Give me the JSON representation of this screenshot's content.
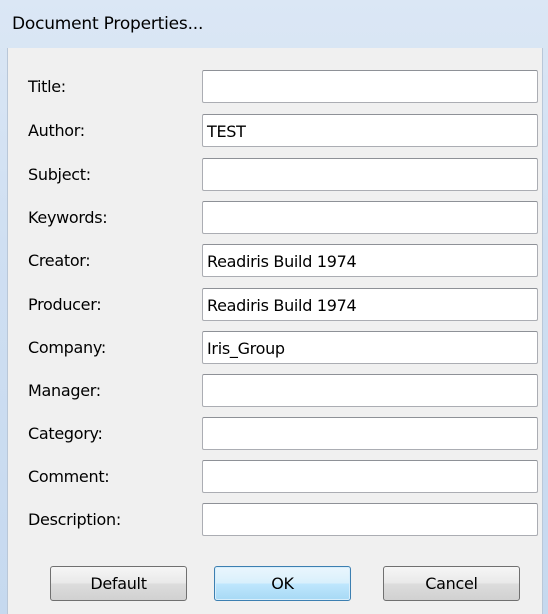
{
  "dialog": {
    "title": "Document Properties..."
  },
  "fields": [
    {
      "label": "Title:",
      "value": ""
    },
    {
      "label": "Author:",
      "value": "TEST"
    },
    {
      "label": "Subject:",
      "value": ""
    },
    {
      "label": "Keywords:",
      "value": ""
    },
    {
      "label": "Creator:",
      "value": "Readiris Build 1974"
    },
    {
      "label": "Producer:",
      "value": "Readiris Build 1974"
    },
    {
      "label": "Company:",
      "value": "Iris_Group"
    },
    {
      "label": "Manager:",
      "value": ""
    },
    {
      "label": "Category:",
      "value": ""
    },
    {
      "label": "Comment:",
      "value": ""
    },
    {
      "label": "Description:",
      "value": ""
    }
  ],
  "buttons": {
    "default_label": "Default",
    "ok_label": "OK",
    "cancel_label": "Cancel"
  }
}
